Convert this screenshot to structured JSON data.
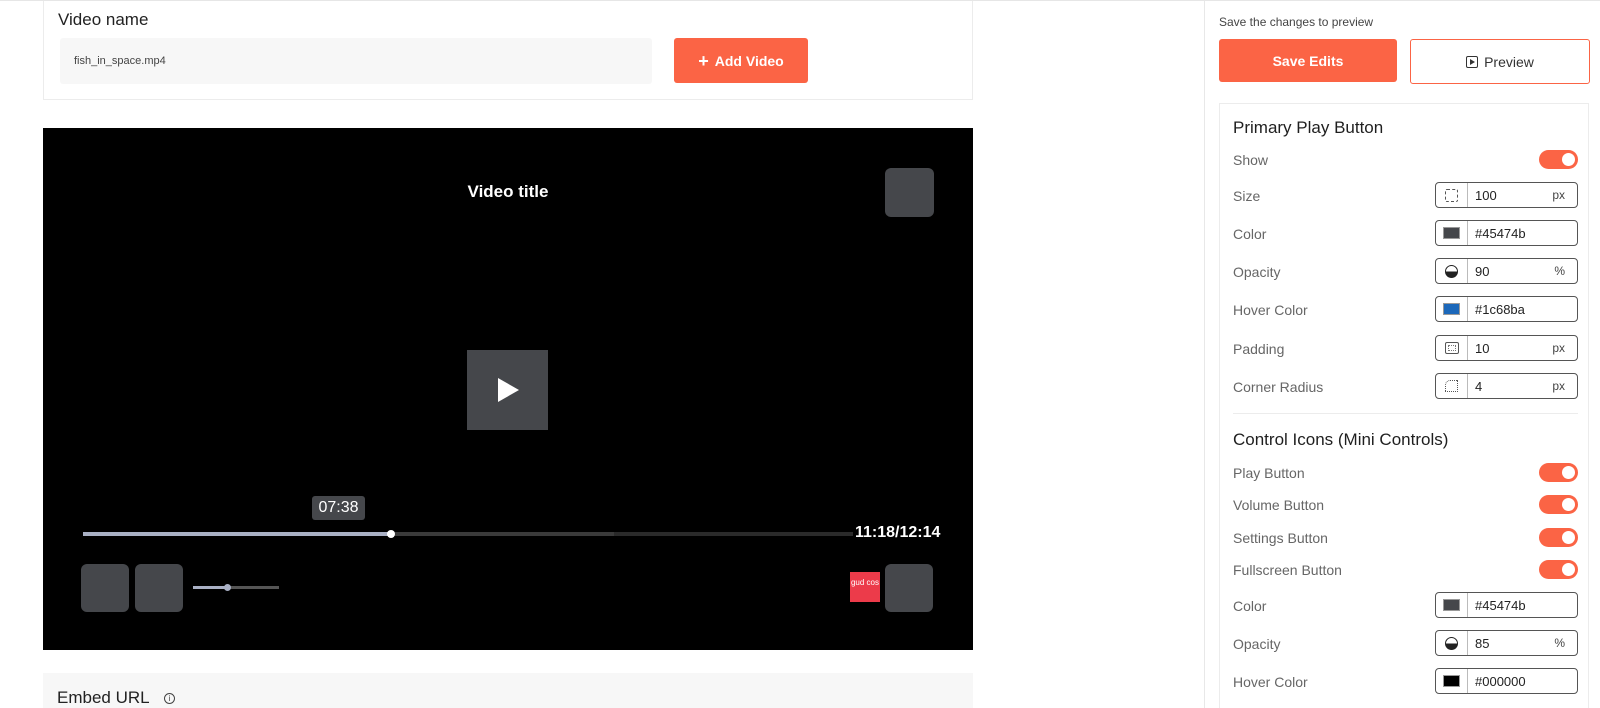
{
  "video_name": {
    "label": "Video name",
    "value": "fish_in_space.mp4",
    "add_button": "Add Video"
  },
  "player": {
    "title": "Video title",
    "scrub_tooltip": "07:38",
    "time_display": "11:18/12:14",
    "progress_fraction": 0.4,
    "buffered_fraction": 0.69,
    "volume_fraction": 0.4,
    "brand_text": "gud cos",
    "brand_color": "#ec3b4a"
  },
  "embed": {
    "label": "Embed URL"
  },
  "panel": {
    "hint": "Save the changes to preview",
    "save_label": "Save Edits",
    "preview_label": "Preview",
    "accent": "#fb6445"
  },
  "primary_play": {
    "title": "Primary Play Button",
    "show_label": "Show",
    "show_on": true,
    "size_label": "Size",
    "size_value": "100",
    "size_unit": "px",
    "color_label": "Color",
    "color_value": "#45474b",
    "opacity_label": "Opacity",
    "opacity_value": "90",
    "opacity_unit": "%",
    "hover_label": "Hover Color",
    "hover_value": "#1c68ba",
    "padding_label": "Padding",
    "padding_value": "10",
    "padding_unit": "px",
    "radius_label": "Corner Radius",
    "radius_value": "4",
    "radius_unit": "px"
  },
  "mini_controls": {
    "title": "Control Icons (Mini Controls)",
    "play_label": "Play Button",
    "volume_label": "Volume Button",
    "settings_label": "Settings Button",
    "fullscreen_label": "Fullscreen Button",
    "color_label": "Color",
    "color_value": "#45474b",
    "opacity_label": "Opacity",
    "opacity_value": "85",
    "opacity_unit": "%",
    "hover_label": "Hover Color",
    "hover_value": "#000000"
  }
}
